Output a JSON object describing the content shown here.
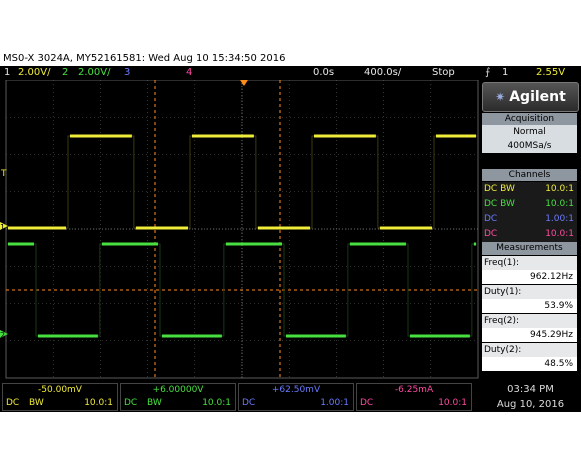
{
  "title": "MS0-X 3024A, MY52161581: Wed Aug 10 15:34:50 2016",
  "topbar": {
    "ch1_num": "1",
    "ch1_scale": "2.00V/",
    "ch2_num": "2",
    "ch2_scale": "2.00V/",
    "ch3_num": "3",
    "ch4_num": "4",
    "time_offset": "0.0s",
    "time_scale": "400.0s/",
    "run_state": "Stop",
    "trigger_icon": "rising-edge-trigger-icon",
    "trigger_source": "1",
    "trigger_level": "2.55V"
  },
  "markers": {
    "ch1": "1",
    "ch2": "2",
    "trigger": "T"
  },
  "brand": "Agilent",
  "acquisition": {
    "header": "Acquisition",
    "mode": "Normal",
    "rate": "400MSa/s"
  },
  "channels": {
    "header": "Channels",
    "rows": [
      {
        "coupling": "DC",
        "bw": "BW",
        "probe": "10.0:1",
        "color": "#f0ec3a"
      },
      {
        "coupling": "DC",
        "bw": "BW",
        "probe": "10.0:1",
        "color": "#48e040"
      },
      {
        "coupling": "DC",
        "bw": "",
        "probe": "1.00:1",
        "color": "#6a7aff"
      },
      {
        "coupling": "DC",
        "bw": "",
        "probe": "10.0:1",
        "color": "#ff4aa0"
      }
    ]
  },
  "measurements": {
    "header": "Measurements",
    "items": [
      {
        "label": "Freq(1):",
        "value": "962.12Hz"
      },
      {
        "label": "Duty(1):",
        "value": "53.9%"
      },
      {
        "label": "Freq(2):",
        "value": "945.29Hz"
      },
      {
        "label": "Duty(2):",
        "value": "48.5%"
      }
    ]
  },
  "bottom": [
    {
      "value": "-50.00mV",
      "dc": "DC",
      "bw": "BW",
      "probe": "10.0:1",
      "color": "#f0ec3a"
    },
    {
      "value": "+6.00000V",
      "dc": "DC",
      "bw": "BW",
      "probe": "10.0:1",
      "color": "#48e040"
    },
    {
      "value": "+62.50mV",
      "dc": "DC",
      "bw": "",
      "probe": "1.00:1",
      "color": "#6a7aff"
    },
    {
      "value": "-6.25mA",
      "dc": "DC",
      "bw": "",
      "probe": "10.0:1",
      "color": "#ff4aa0"
    }
  ],
  "clock": {
    "time": "03:34 PM",
    "date": "Aug 10, 2016"
  },
  "colors": {
    "ch1": "#f0ec3a",
    "ch2": "#48e040",
    "cursor": "#ff8c1a",
    "grid": "#5a5a5a"
  }
}
